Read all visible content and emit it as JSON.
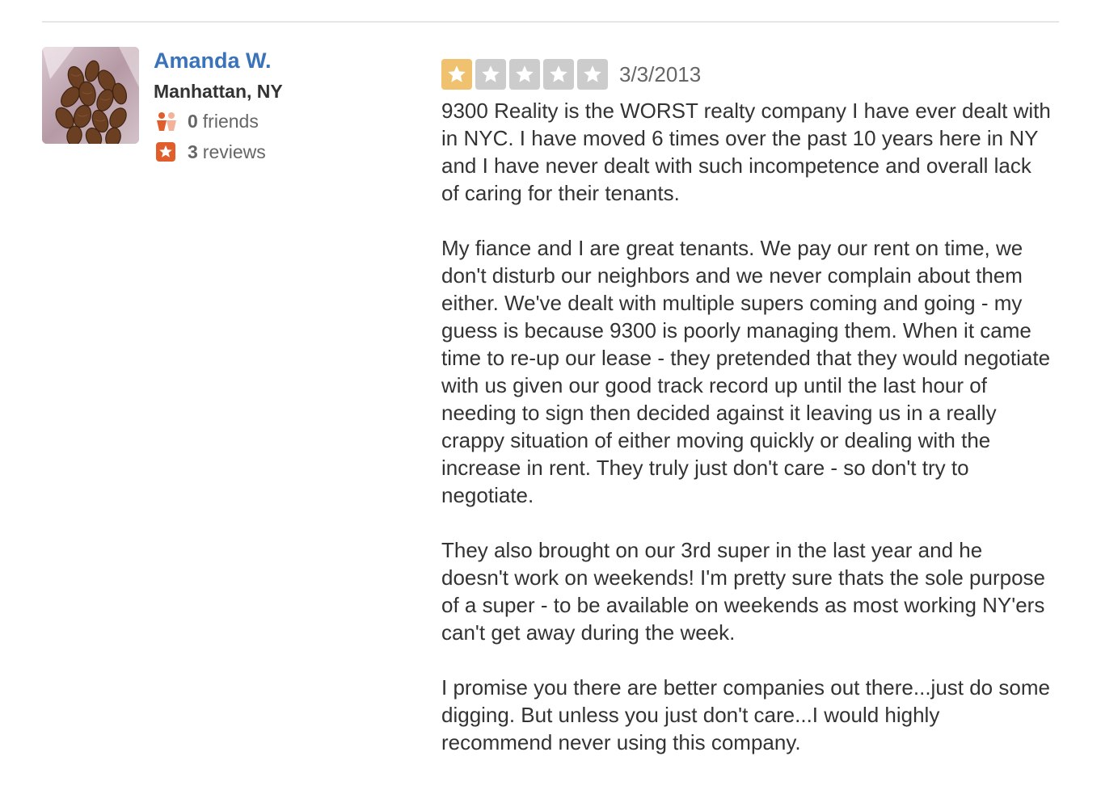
{
  "user": {
    "name": "Amanda W.",
    "location": "Manhattan, NY",
    "friends_count": "0",
    "friends_label": "friends",
    "reviews_count": "3",
    "reviews_label": "reviews",
    "avatar_icon": "user-photo-avatar"
  },
  "review": {
    "rating": 1,
    "rating_max": 5,
    "date": "3/3/2013",
    "paragraphs": [
      "9300 Reality is the WORST realty company I have ever dealt with in NYC. I have moved 6 times over the past 10 years here in NY and I have never dealt with such incompetence and overall lack of caring for their tenants.",
      "My fiance and I are great tenants. We pay our rent on time, we don't disturb our neighbors and we never complain about them either. We've dealt with multiple supers coming and going - my guess is because 9300 is poorly managing them. When it came time to re-up our lease - they pretended that they would negotiate with us given our good track record up until the last hour of needing to sign then decided against it leaving us in a really crappy situation of either moving quickly or dealing with the increase in rent. They truly just don't care - so don't try to negotiate.",
      "They also brought on our 3rd super in the last year and he doesn't work on weekends! I'm pretty sure thats the sole purpose of a super - to be available on weekends as most working NY'ers can't get away during the week.",
      "I promise you there are better companies out there...just do some digging. But unless you just don't care...I would highly recommend never using this company."
    ]
  },
  "colors": {
    "link_blue": "#3b73b9",
    "star_filled": "#f0c26f",
    "star_empty": "#cccccc",
    "icon_orange": "#e05d2c",
    "divider": "#e6e6e6"
  }
}
